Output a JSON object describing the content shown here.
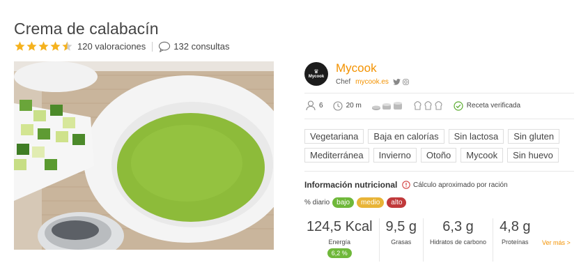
{
  "recipe": {
    "title": "Crema de calabacín",
    "rating": 4.5,
    "ratings_label": "120 valoraciones",
    "views_label": "132 consultas"
  },
  "chef": {
    "name": "Mycook",
    "role": "Chef",
    "site": "mycook.es",
    "logo_text": "Mycook"
  },
  "info": {
    "servings": "6",
    "time": "20 m",
    "verified": "Receta verificada",
    "difficulty_icon": "pots-icon",
    "cost_icon": "chef-hats-icon"
  },
  "tags": [
    "Vegetariana",
    "Baja en calorías",
    "Sin lactosa",
    "Sin gluten",
    "Mediterránea",
    "Invierno",
    "Otoño",
    "Mycook",
    "Sin huevo"
  ],
  "nutrition": {
    "title": "Información nutricional",
    "note": "Cálculo aproximado por ración",
    "daily_label": "% diario",
    "levels": {
      "low": "bajo",
      "mid": "medio",
      "high": "alto"
    },
    "items": [
      {
        "value": "124,5 Kcal",
        "label": "Energía",
        "percent": "6,2 %"
      },
      {
        "value": "9,5 g",
        "label": "Grasas"
      },
      {
        "value": "6,3 g",
        "label": "Hidratos de carbono"
      },
      {
        "value": "4,8 g",
        "label": "Proteínas"
      }
    ],
    "more": "Ver más  >"
  },
  "colors": {
    "accent": "#f39200",
    "low": "#6fb83a",
    "mid": "#e8b437",
    "high": "#c0393b"
  }
}
